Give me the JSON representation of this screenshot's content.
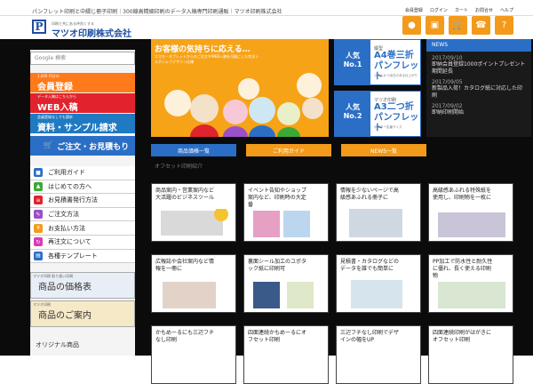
{
  "header": {
    "tagline": "パンフレット印刷と中綴じ冊子印刷｜300線高精細印刷のデータ入稿専門印刷通販｜マツオ印刷株式会社",
    "utility": [
      "会員登録",
      "ログイン",
      "カート",
      "お問合せ",
      "ヘルプ"
    ],
    "logo_small": "印刷と共にある仲良くする",
    "logo_text": "マツオ印刷株式会社",
    "logo_mark": "P"
  },
  "icons": [
    "user-icon",
    "login-icon",
    "cart-icon",
    "phone-icon",
    "help-icon"
  ],
  "colors": {
    "orange": "#f39a1a",
    "blue": "#2b6ec6",
    "red": "#e0232c",
    "dark": "#0b0b0b"
  },
  "sidebar": {
    "search_placeholder": "Google 検索",
    "banner1_small": "1,000 円分の",
    "banner1_large": "会員登録",
    "banner2_small": "データ入稿はこちらから",
    "banner2_large": "WEB入稿",
    "banner3_small": "会員登録なしでも請求",
    "banner3_large": "資料・サンプル請求",
    "banner4_large": "ご注文・お見積もり",
    "nav": [
      "ご利用ガイド",
      "はじめての方へ",
      "お見積書発行方法",
      "ご注文方法",
      "お支払い方法",
      "再注文について",
      "各種テンプレート"
    ],
    "tile1_small": "マツオ印刷 取り扱い印刷",
    "tile1": "商品の価格表",
    "tile2_small": "マツオ印刷",
    "tile2": "商品のご案内",
    "original": "オリジナル商品"
  },
  "hero": {
    "title": "お客様の気持ちに応える…",
    "text": "スマホ・タブレットからのご注文やWEB入稿を可能にした完全レスポンシブデザイン仕様"
  },
  "promos": [
    {
      "kind": "縦型",
      "title": "A4巻三折",
      "subtitle": "パンフレット",
      "badge_top": "人気",
      "badge_bottom": "No.1",
      "desc": "スリムかつ余白のある仕上がり"
    },
    {
      "kind": "マツオ印刷",
      "title": "A3二つ折",
      "subtitle": "パンフレット",
      "badge_top": "人気",
      "badge_bottom": "No.2",
      "desc": "ポスター定番サイズ"
    }
  ],
  "news": {
    "heading": "NEWS",
    "items": [
      {
        "date": "2017/09/10",
        "text": "即納会員登録1000ポイントプレゼント期間延長"
      },
      {
        "date": "2017/09/05",
        "text": "新製品入荷！カタログ紙に対応した印刷"
      },
      {
        "date": "2017/09/02",
        "text": "即納印刷開始"
      }
    ]
  },
  "tabs": [
    "商品価格一覧",
    "ご利用ガイド",
    "NEWS一覧"
  ],
  "section_title": "オフセット印刷紹介",
  "cards": [
    "商品案内・営業案内など大活躍のビジネスツール",
    "イベント告知やショップ案内など、印刷時の大定番",
    "情報を少ないページで高級感あふれる冊子に",
    "高級感あふれる特殊紙を使用し、印刷物を一枚に",
    "広報誌や会社案内など情報を一冊に",
    "裏面シール加工のユポタック紙に印刷可",
    "見積書・カタログなどのデータを誰でも簡単に",
    "PP加工で防水性と耐久性に優れ、長く使える印刷物",
    "かもめーるにも三辺フチなし印刷",
    "四面連続かもめーるにオフセット印刷",
    "三辺フチなし印刷でデザインの幅をUP",
    "四面連続印刷がはがきにオフセット印刷"
  ]
}
